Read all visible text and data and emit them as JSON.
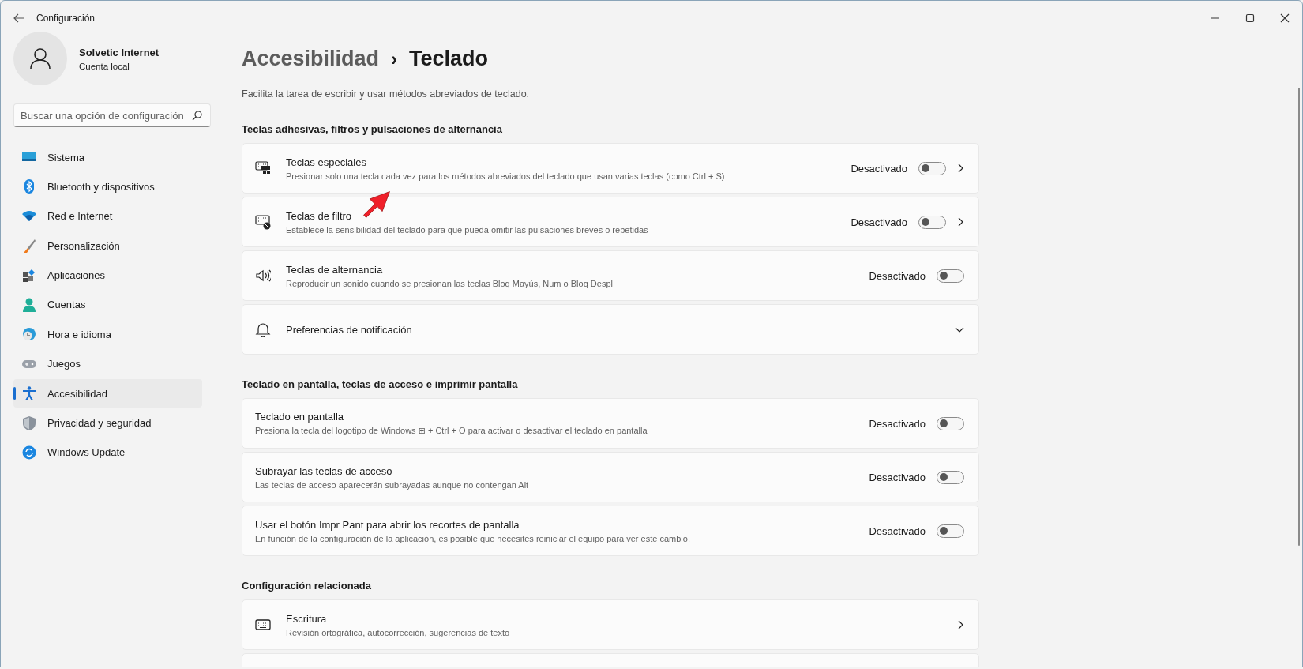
{
  "window": {
    "title": "Configuración"
  },
  "profile": {
    "name": "Solvetic Internet",
    "account": "Cuenta local"
  },
  "search": {
    "placeholder": "Buscar una opción de configuración"
  },
  "sidebar": {
    "items": [
      {
        "label": "Sistema",
        "selected": false
      },
      {
        "label": "Bluetooth y dispositivos",
        "selected": false
      },
      {
        "label": "Red e Internet",
        "selected": false
      },
      {
        "label": "Personalización",
        "selected": false
      },
      {
        "label": "Aplicaciones",
        "selected": false
      },
      {
        "label": "Cuentas",
        "selected": false
      },
      {
        "label": "Hora e idioma",
        "selected": false
      },
      {
        "label": "Juegos",
        "selected": false
      },
      {
        "label": "Accesibilidad",
        "selected": true
      },
      {
        "label": "Privacidad y seguridad",
        "selected": false
      },
      {
        "label": "Windows Update",
        "selected": false
      }
    ]
  },
  "breadcrumb": {
    "parent": "Accesibilidad",
    "separator": "›",
    "current": "Teclado"
  },
  "description": "Facilita la tarea de escribir y usar métodos abreviados de teclado.",
  "sections": [
    {
      "heading": "Teclas adhesivas, filtros y pulsaciones de alternancia",
      "rows": [
        {
          "kind": "toggle-link",
          "title": "Teclas especiales",
          "description": "Presionar solo una tecla cada vez para los métodos abreviados del teclado que usan varias teclas (como Ctrl + S)",
          "status": "Desactivado",
          "on": false
        },
        {
          "kind": "toggle-link",
          "title": "Teclas de filtro",
          "description": "Establece la sensibilidad del teclado para que pueda omitir las pulsaciones breves o repetidas",
          "status": "Desactivado",
          "on": false
        },
        {
          "kind": "toggle",
          "title": "Teclas de alternancia",
          "description": "Reproducir un sonido cuando se presionan las teclas Bloq Mayús, Num o Bloq Despl",
          "status": "Desactivado",
          "on": false
        },
        {
          "kind": "expander",
          "title": "Preferencias de notificación"
        }
      ]
    },
    {
      "heading": "Teclado en pantalla, teclas de acceso e imprimir pantalla",
      "rows": [
        {
          "kind": "toggle",
          "title": "Teclado en pantalla",
          "description": "Presiona la tecla del logotipo de Windows ⊞ + Ctrl + O para activar o desactivar el teclado en pantalla",
          "status": "Desactivado",
          "on": false
        },
        {
          "kind": "toggle",
          "title": "Subrayar las teclas de acceso",
          "description": "Las teclas de acceso aparecerán subrayadas aunque no contengan Alt",
          "status": "Desactivado",
          "on": false
        },
        {
          "kind": "toggle",
          "title": "Usar el botón Impr Pant para abrir los recortes de pantalla",
          "description": "En función de la configuración de la aplicación, es posible que necesites reiniciar el equipo para ver este cambio.",
          "status": "Desactivado",
          "on": false
        }
      ]
    },
    {
      "heading": "Configuración relacionada",
      "rows": [
        {
          "kind": "link",
          "title": "Escritura",
          "description": "Revisión ortográfica, autocorrección, sugerencias de texto"
        },
        {
          "kind": "partial"
        }
      ]
    }
  ]
}
